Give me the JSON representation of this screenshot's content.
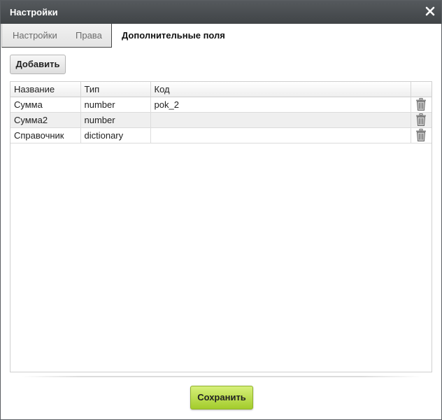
{
  "window": {
    "title": "Настройки",
    "close_icon": "close-icon"
  },
  "tabs": {
    "items": [
      {
        "label": "Настройки"
      },
      {
        "label": "Права"
      }
    ],
    "active": {
      "label": "Дополнительные поля"
    }
  },
  "toolbar": {
    "add_label": "Добавить"
  },
  "table": {
    "columns": [
      "Название",
      "Тип",
      "Код",
      ""
    ],
    "rows": [
      {
        "name": "Сумма",
        "type": "number",
        "code": "pok_2",
        "action_icon": "trash-icon"
      },
      {
        "name": "Сумма2",
        "type": "number",
        "code": "",
        "action_icon": "trash-icon"
      },
      {
        "name": "Справочник",
        "type": "dictionary",
        "code": "",
        "action_icon": "trash-icon"
      }
    ]
  },
  "footer": {
    "save_label": "Сохранить"
  },
  "colors": {
    "titlebar": "#4a4e52",
    "save_button": "#b5db3e",
    "row_alt": "#efefef"
  }
}
